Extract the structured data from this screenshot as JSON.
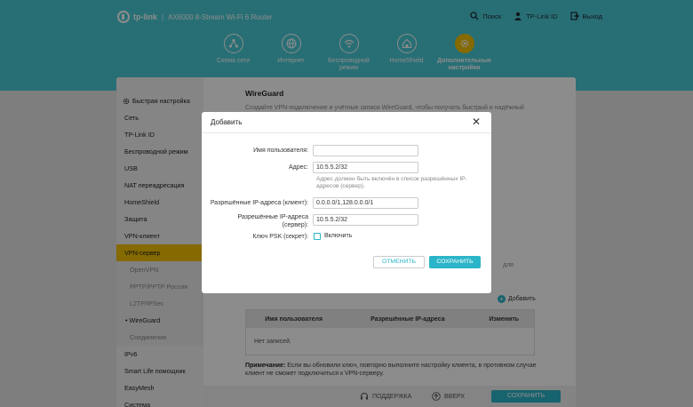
{
  "header": {
    "logo_text": "tp-link",
    "product": "AX6000 8-Stream Wi-Fi 6 Router",
    "links": [
      {
        "label": "Поиск",
        "icon": "search-icon"
      },
      {
        "label": "TP-Link ID",
        "icon": "user-icon"
      },
      {
        "label": "Выход",
        "icon": "logout-icon"
      }
    ]
  },
  "nav": [
    {
      "label": "Схема сети",
      "icon": "network-map-icon"
    },
    {
      "label": "Интернет",
      "icon": "globe-icon"
    },
    {
      "label": "Беспроводной режим",
      "icon": "wifi-icon"
    },
    {
      "label": "HomeShield",
      "icon": "house-shield-icon"
    },
    {
      "label": "Дополнительные настройки",
      "icon": "gear-icon",
      "active": true
    }
  ],
  "sidebar": {
    "items": [
      "Быстрая настройка",
      "Сеть",
      "TP-Link ID",
      "Беспроводной режим",
      "USB",
      "NAT переадресация",
      "HomeShield",
      "Защита",
      "VPN-клиент",
      "VPN-сервер",
      "OpenVPN",
      "PPTP/PPTP Россия",
      "L2TP/IPSec",
      "WireGuard",
      "Соединения",
      "IPv6",
      "Smart Life помощник",
      "EasyMesh",
      "Система"
    ]
  },
  "content": {
    "title": "WireGuard",
    "description": "Создайте VPN-подключение и учётные записи WireGuard, чтобы получать быстрый и надёжный",
    "behind_text": "для",
    "add_label": "Добавить",
    "table": {
      "headers": [
        "Имя пользователя",
        "Разрешённые IP-адреса",
        "Изменить"
      ],
      "empty": "Нет записей."
    },
    "note_label": "Примечание:",
    "note_text": "Если вы обновили ключ, повторно выполните настройку клиента, в противном случае клиент не сможет подключиться к VPN-серверу."
  },
  "footer": {
    "support": "ПОДДЕРЖКА",
    "top": "ВВЕРХ",
    "save": "СОХРАНИТЬ"
  },
  "modal": {
    "title": "Добавить",
    "username_label": "Имя пользователя:",
    "username_value": "",
    "address_label": "Адрес:",
    "address_value": "10.5.5.2/32",
    "address_hint": "Адрес должен быть включён в список разрешённых IP-адресов (сервер).",
    "allowed_client_label": "Разрешённые IP-адреса (клиент):",
    "allowed_client_value": "0.0.0.0/1,128.0.0.0/1",
    "allowed_server_label": "Разрешённые IP-адреса (сервер):",
    "allowed_server_value": "10.5.5.2/32",
    "psk_label": "Ключ PSK (секрет):",
    "psk_checkbox_label": "Включить",
    "cancel": "ОТМЕНИТЬ",
    "save": "СОХРАНИТЬ"
  }
}
